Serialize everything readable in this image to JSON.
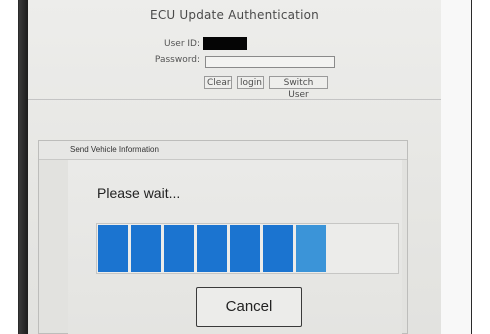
{
  "auth": {
    "title": "ECU Update Authentication",
    "user_id_label": "User ID:",
    "password_label": "Password:",
    "password_value": "",
    "buttons": {
      "clear": "Clear",
      "login": "login",
      "switch_user": "Switch User"
    }
  },
  "dialog": {
    "title": "Send Vehicle Information",
    "message": "Please wait...",
    "progress": {
      "total_segments": 9,
      "filled_segments": 6,
      "partial_segments": 1,
      "color": "#1b74d0"
    },
    "cancel_label": "Cancel"
  }
}
